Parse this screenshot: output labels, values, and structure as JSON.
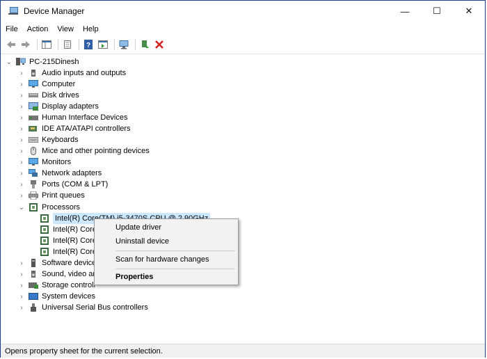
{
  "window": {
    "title": "Device Manager"
  },
  "caption": {
    "minimize": "—",
    "maximize": "☐",
    "close": "✕"
  },
  "menu": [
    "File",
    "Action",
    "View",
    "Help"
  ],
  "tree": {
    "root": "PC-215Dinesh",
    "categories": [
      {
        "label": "Audio inputs and outputs",
        "icon": "speaker-icon"
      },
      {
        "label": "Computer",
        "icon": "computer-icon"
      },
      {
        "label": "Disk drives",
        "icon": "disk-icon"
      },
      {
        "label": "Display adapters",
        "icon": "display-adapter-icon"
      },
      {
        "label": "Human Interface Devices",
        "icon": "hid-icon"
      },
      {
        "label": "IDE ATA/ATAPI controllers",
        "icon": "ide-icon"
      },
      {
        "label": "Keyboards",
        "icon": "keyboard-icon"
      },
      {
        "label": "Mice and other pointing devices",
        "icon": "mouse-icon"
      },
      {
        "label": "Monitors",
        "icon": "monitor-icon"
      },
      {
        "label": "Network adapters",
        "icon": "network-icon"
      },
      {
        "label": "Ports (COM & LPT)",
        "icon": "port-icon"
      },
      {
        "label": "Print queues",
        "icon": "printer-icon"
      }
    ],
    "processors": {
      "label": "Processors",
      "children": [
        "Intel(R) Core(TM) i5-3470S CPU @ 2.90GHz",
        "Intel(R) Core",
        "Intel(R) Core",
        "Intel(R) Core"
      ]
    },
    "after": [
      {
        "label": "Software device",
        "icon": "software-icon"
      },
      {
        "label": "Sound, video an",
        "icon": "sound-icon"
      },
      {
        "label": "Storage controll",
        "icon": "storage-icon"
      },
      {
        "label": "System devices",
        "icon": "system-icon"
      },
      {
        "label": "Universal Serial Bus controllers",
        "icon": "usb-icon"
      }
    ]
  },
  "context_menu": {
    "update": "Update driver",
    "uninstall": "Uninstall device",
    "scan": "Scan for hardware changes",
    "properties": "Properties"
  },
  "status": "Opens property sheet for the current selection."
}
